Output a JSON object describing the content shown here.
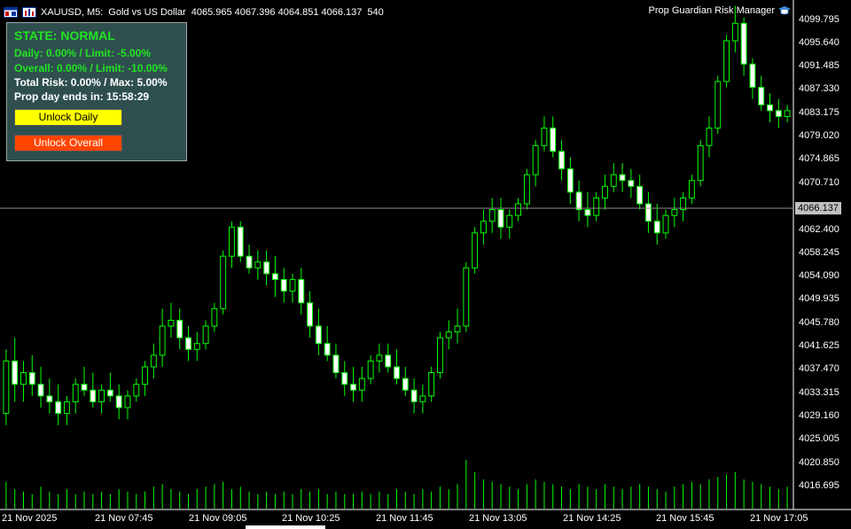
{
  "header": {
    "symbol": "XAUUSD, M5:",
    "description": "Gold vs US Dollar",
    "ohlc": "4065.965 4067.396 4064.851 4066.137",
    "volume": "540",
    "ea_name": "Prop Guardian Risk Manager",
    "icons": [
      "chart-window-icon",
      "ea-hat-icon"
    ]
  },
  "panel": {
    "state": "STATE: NORMAL",
    "daily": "Daily: 0.00% / Limit: -5.00%",
    "overall": "Overall: 0.00% / Limit: -10.00%",
    "total_risk": "Total Risk: 0.00% / Max: 5.00%",
    "prop_day": "Prop day ends in: 15:58:29",
    "unlock_daily": "Unlock Daily",
    "unlock_overall": "Unlock Overall"
  },
  "price_axis": [
    "4099.795",
    "4095.640",
    "4091.485",
    "4087.330",
    "4083.175",
    "4079.020",
    "4074.865",
    "4070.710",
    "4066.137",
    "4062.400",
    "4058.245",
    "4054.090",
    "4049.935",
    "4045.780",
    "4041.625",
    "4037.470",
    "4033.315",
    "4029.160",
    "4025.005",
    "4020.850",
    "4016.695"
  ],
  "current_price": "4066.137",
  "time_axis": [
    "21 Nov 2025",
    "21 Nov 07:45",
    "21 Nov 09:05",
    "21 Nov 10:25",
    "21 Nov 11:45",
    "21 Nov 13:05",
    "21 Nov 14:25",
    "21 Nov 15:45",
    "21 Nov 17:05"
  ],
  "colors": {
    "bull": "#00ff00",
    "bear": "#ffffff",
    "panel_bg": "#2f4f4f",
    "state": "#22e322",
    "daily_btn": "#ffff00",
    "overall_btn": "#ff4500"
  },
  "chart_data": {
    "type": "candlestick",
    "symbol": "XAUUSD",
    "timeframe": "M5",
    "ylim": [
      4014.5,
      4102.0
    ],
    "candles": [
      [
        4031,
        4042,
        4029,
        4040
      ],
      [
        4040,
        4044,
        4033,
        4036
      ],
      [
        4036,
        4040,
        4033,
        4038
      ],
      [
        4038,
        4041,
        4034,
        4036
      ],
      [
        4036,
        4039,
        4032,
        4034
      ],
      [
        4034,
        4037,
        4031,
        4033
      ],
      [
        4033,
        4036,
        4029,
        4031
      ],
      [
        4031,
        4034,
        4029,
        4033
      ],
      [
        4033,
        4037,
        4031,
        4036
      ],
      [
        4036,
        4039,
        4034,
        4035
      ],
      [
        4035,
        4038,
        4032,
        4033
      ],
      [
        4033,
        4036,
        4031,
        4035
      ],
      [
        4035,
        4038,
        4033,
        4034
      ],
      [
        4034,
        4036,
        4030,
        4032
      ],
      [
        4032,
        4035,
        4030,
        4034
      ],
      [
        4034,
        4037,
        4033,
        4036
      ],
      [
        4036,
        4040,
        4034,
        4039
      ],
      [
        4039,
        4043,
        4037,
        4041
      ],
      [
        4041,
        4049,
        4039,
        4046
      ],
      [
        4046,
        4050,
        4044,
        4047
      ],
      [
        4047,
        4049,
        4042,
        4044
      ],
      [
        4044,
        4046,
        4040,
        4042
      ],
      [
        4042,
        4045,
        4040,
        4043
      ],
      [
        4043,
        4047,
        4042,
        4046
      ],
      [
        4046,
        4050,
        4045,
        4049
      ],
      [
        4049,
        4059,
        4048,
        4058
      ],
      [
        4058,
        4064,
        4056,
        4063
      ],
      [
        4063,
        4064,
        4057,
        4058
      ],
      [
        4058,
        4060,
        4055,
        4056
      ],
      [
        4056,
        4059,
        4054,
        4057
      ],
      [
        4057,
        4059,
        4053,
        4055
      ],
      [
        4055,
        4058,
        4051,
        4054
      ],
      [
        4054,
        4056,
        4050,
        4052
      ],
      [
        4052,
        4055,
        4050,
        4054
      ],
      [
        4054,
        4056,
        4048,
        4050
      ],
      [
        4050,
        4052,
        4044,
        4046
      ],
      [
        4046,
        4049,
        4041,
        4043
      ],
      [
        4043,
        4046,
        4040,
        4041
      ],
      [
        4041,
        4043,
        4037,
        4038
      ],
      [
        4038,
        4040,
        4034,
        4036
      ],
      [
        4036,
        4039,
        4033,
        4035
      ],
      [
        4035,
        4039,
        4033,
        4037
      ],
      [
        4037,
        4041,
        4036,
        4040
      ],
      [
        4040,
        4043,
        4038,
        4041
      ],
      [
        4041,
        4043,
        4038,
        4039
      ],
      [
        4039,
        4042,
        4036,
        4037
      ],
      [
        4037,
        4039,
        4034,
        4035
      ],
      [
        4035,
        4037,
        4031,
        4033
      ],
      [
        4033,
        4036,
        4031,
        4034
      ],
      [
        4034,
        4039,
        4033,
        4038
      ],
      [
        4038,
        4045,
        4037,
        4044
      ],
      [
        4044,
        4047,
        4042,
        4045
      ],
      [
        4045,
        4049,
        4043,
        4046
      ],
      [
        4046,
        4057,
        4045,
        4056
      ],
      [
        4056,
        4063,
        4055,
        4062
      ],
      [
        4062,
        4066,
        4060,
        4064
      ],
      [
        4064,
        4068,
        4062,
        4066
      ],
      [
        4066,
        4068,
        4061,
        4063
      ],
      [
        4063,
        4066,
        4061,
        4065
      ],
      [
        4065,
        4068,
        4064,
        4067
      ],
      [
        4067,
        4073,
        4066,
        4072
      ],
      [
        4072,
        4078,
        4070,
        4077
      ],
      [
        4077,
        4082,
        4076,
        4080
      ],
      [
        4080,
        4082,
        4075,
        4076
      ],
      [
        4076,
        4078,
        4071,
        4073
      ],
      [
        4073,
        4075,
        4067,
        4069
      ],
      [
        4069,
        4071,
        4064,
        4066
      ],
      [
        4066,
        4069,
        4063,
        4065
      ],
      [
        4065,
        4069,
        4064,
        4068
      ],
      [
        4068,
        4072,
        4066,
        4070
      ],
      [
        4070,
        4074,
        4069,
        4072
      ],
      [
        4072,
        4074,
        4069,
        4071
      ],
      [
        4071,
        4073,
        4068,
        4070
      ],
      [
        4070,
        4072,
        4066,
        4067
      ],
      [
        4067,
        4069,
        4062,
        4064
      ],
      [
        4064,
        4067,
        4060,
        4062
      ],
      [
        4062,
        4066,
        4061,
        4065
      ],
      [
        4065,
        4068,
        4063,
        4066
      ],
      [
        4066,
        4069,
        4064,
        4068
      ],
      [
        4068,
        4072,
        4067,
        4071
      ],
      [
        4071,
        4078,
        4070,
        4077
      ],
      [
        4077,
        4082,
        4075,
        4080
      ],
      [
        4080,
        4089,
        4079,
        4088
      ],
      [
        4088,
        4096,
        4087,
        4095
      ],
      [
        4095,
        4101,
        4093,
        4098
      ],
      [
        4098,
        4099,
        4089,
        4091
      ],
      [
        4091,
        4092,
        4085,
        4087
      ],
      [
        4087,
        4089,
        4083,
        4084
      ],
      [
        4084,
        4086,
        4081,
        4083
      ],
      [
        4083,
        4085,
        4080,
        4082
      ],
      [
        4082,
        4084,
        4081,
        4083
      ]
    ],
    "volume_relative": [
      0.55,
      0.4,
      0.35,
      0.3,
      0.45,
      0.35,
      0.3,
      0.4,
      0.3,
      0.35,
      0.3,
      0.35,
      0.3,
      0.4,
      0.35,
      0.3,
      0.35,
      0.45,
      0.5,
      0.4,
      0.35,
      0.3,
      0.4,
      0.45,
      0.5,
      0.55,
      0.4,
      0.45,
      0.35,
      0.3,
      0.35,
      0.3,
      0.35,
      0.3,
      0.4,
      0.35,
      0.4,
      0.3,
      0.35,
      0.3,
      0.3,
      0.35,
      0.3,
      0.35,
      0.3,
      0.4,
      0.35,
      0.3,
      0.4,
      0.35,
      0.45,
      0.4,
      0.5,
      1.0,
      0.75,
      0.6,
      0.55,
      0.5,
      0.45,
      0.4,
      0.5,
      0.6,
      0.55,
      0.5,
      0.45,
      0.4,
      0.5,
      0.45,
      0.4,
      0.5,
      0.45,
      0.4,
      0.45,
      0.5,
      0.45,
      0.4,
      0.35,
      0.45,
      0.5,
      0.55,
      0.5,
      0.6,
      0.65,
      0.7,
      0.75,
      0.6,
      0.55,
      0.5,
      0.45,
      0.4,
      0.45,
      0.4
    ]
  }
}
